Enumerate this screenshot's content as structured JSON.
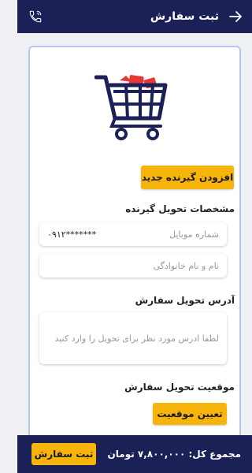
{
  "header": {
    "title": "ثبت سفارش"
  },
  "cart_illustration": {
    "icon": "shopping-cart-icon",
    "stroke": "#1b2057",
    "accent": "#e53935"
  },
  "add_recipient_button": "افزودن گیرنده جدید",
  "recipient_section": {
    "label": "مشخصات تحویل گیرنده",
    "mobile": {
      "placeholder": "شماره موبایل",
      "value": "۰۹۱۲*******"
    },
    "name": {
      "placeholder": "نام و نام خانوادگی"
    }
  },
  "address_section": {
    "label": "آدرس تحویل سفارش",
    "placeholder": "لطفا ادرس مورد نظر برای تحویل را وارد کنید"
  },
  "location_section": {
    "label": "موقعیت تحویل سفارش",
    "button": "تعیین موقعیت"
  },
  "footer": {
    "total": "مجموع کل: ۷,۸۰۰,۰۰۰ تومان",
    "submit": "ثبت سفارش"
  },
  "colors": {
    "primary": "#1b2057",
    "accent": "#f7b40a",
    "card_border": "#b8c6ea"
  }
}
